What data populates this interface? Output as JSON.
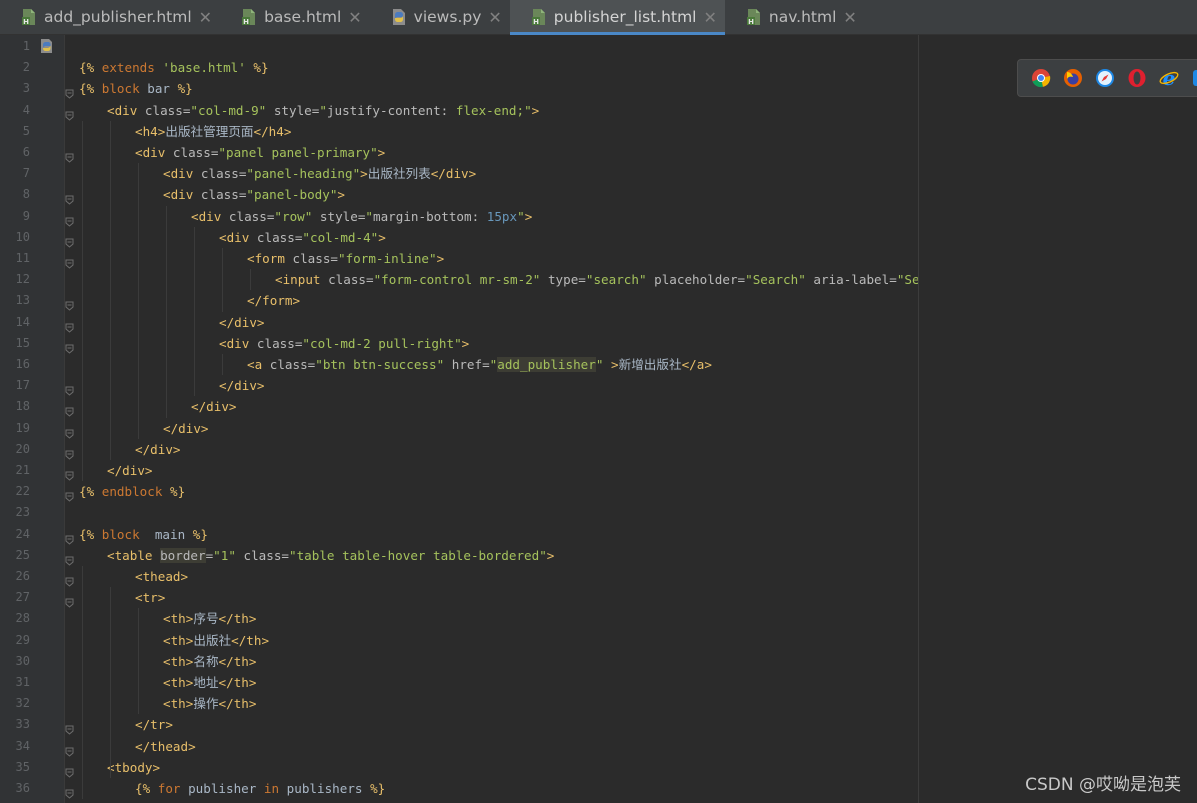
{
  "tabs": [
    {
      "label": "add_publisher.html",
      "type": "html",
      "active": false
    },
    {
      "label": "base.html",
      "type": "html",
      "active": false
    },
    {
      "label": "views.py",
      "type": "python",
      "active": false
    },
    {
      "label": "publisher_list.html",
      "type": "html",
      "active": true
    },
    {
      "label": "nav.html",
      "type": "html",
      "active": false
    }
  ],
  "close_glyph": "✕",
  "browser_icons": [
    "chrome-icon",
    "firefox-icon",
    "safari-icon",
    "opera-icon",
    "ie-icon",
    "edge-icon"
  ],
  "watermark": "CSDN @哎呦是泡芙",
  "code_lines": [
    {
      "n": "1",
      "indent": 0,
      "tokens": []
    },
    {
      "n": "2",
      "indent": 0,
      "tokens": [
        [
          "tpl",
          "{% "
        ],
        [
          "kw",
          "extends"
        ],
        [
          "text",
          " "
        ],
        [
          "val",
          "'base.html'"
        ],
        [
          "tpl",
          " %}"
        ]
      ]
    },
    {
      "n": "3",
      "indent": 0,
      "tokens": [
        [
          "tpl",
          "{% "
        ],
        [
          "kw",
          "block"
        ],
        [
          "text",
          " bar "
        ],
        [
          "tpl",
          "%}"
        ]
      ]
    },
    {
      "n": "4",
      "indent": 1,
      "tokens": [
        [
          "tag",
          "<div "
        ],
        [
          "attr",
          "class="
        ],
        [
          "val",
          "\"col-md-9\""
        ],
        [
          "attr",
          " style="
        ],
        [
          "val",
          "\""
        ],
        [
          "attr",
          "justify-content: "
        ],
        [
          "val",
          "flex-end;\""
        ],
        [
          "tag",
          ">"
        ]
      ]
    },
    {
      "n": "5",
      "indent": 2,
      "tokens": [
        [
          "tag",
          "<h4>"
        ],
        [
          "text",
          "出版社管理页面"
        ],
        [
          "tag",
          "</h4>"
        ]
      ]
    },
    {
      "n": "6",
      "indent": 2,
      "tokens": [
        [
          "tag",
          "<div "
        ],
        [
          "attr",
          "class="
        ],
        [
          "val",
          "\"panel panel-primary\""
        ],
        [
          "tag",
          ">"
        ]
      ]
    },
    {
      "n": "7",
      "indent": 3,
      "tokens": [
        [
          "tag",
          "<div "
        ],
        [
          "attr",
          "class="
        ],
        [
          "val",
          "\"panel-heading\""
        ],
        [
          "tag",
          ">"
        ],
        [
          "text",
          "出版社列表"
        ],
        [
          "tag",
          "</div>"
        ]
      ]
    },
    {
      "n": "8",
      "indent": 3,
      "tokens": [
        [
          "tag",
          "<div "
        ],
        [
          "attr",
          "class="
        ],
        [
          "val",
          "\"panel-body\""
        ],
        [
          "tag",
          ">"
        ]
      ]
    },
    {
      "n": "9",
      "indent": 4,
      "tokens": [
        [
          "tag",
          "<div "
        ],
        [
          "attr",
          "class="
        ],
        [
          "val",
          "\"row\""
        ],
        [
          "attr",
          " style="
        ],
        [
          "val",
          "\""
        ],
        [
          "attr",
          "margin-bottom: "
        ],
        [
          "num",
          "15px"
        ],
        [
          "val",
          "\""
        ],
        [
          "tag",
          ">"
        ]
      ]
    },
    {
      "n": "10",
      "indent": 5,
      "tokens": [
        [
          "tag",
          "<div "
        ],
        [
          "attr",
          "class="
        ],
        [
          "val",
          "\"col-md-4\""
        ],
        [
          "tag",
          ">"
        ]
      ]
    },
    {
      "n": "11",
      "indent": 6,
      "tokens": [
        [
          "tag",
          "<form "
        ],
        [
          "attr",
          "class="
        ],
        [
          "val",
          "\"form-inline\""
        ],
        [
          "tag",
          ">"
        ]
      ]
    },
    {
      "n": "12",
      "indent": 7,
      "tokens": [
        [
          "tag",
          "<input "
        ],
        [
          "attr",
          "class="
        ],
        [
          "val",
          "\"form-control mr-sm-2\""
        ],
        [
          "attr",
          " type="
        ],
        [
          "val",
          "\"search\""
        ],
        [
          "attr",
          " placeholder="
        ],
        [
          "val",
          "\"Search\""
        ],
        [
          "attr",
          " aria-label="
        ],
        [
          "val",
          "\"Search\""
        ],
        [
          "tag",
          ">"
        ]
      ]
    },
    {
      "n": "13",
      "indent": 6,
      "tokens": [
        [
          "tag",
          "</form>"
        ]
      ]
    },
    {
      "n": "14",
      "indent": 5,
      "tokens": [
        [
          "tag",
          "</div>"
        ]
      ]
    },
    {
      "n": "15",
      "indent": 5,
      "tokens": [
        [
          "tag",
          "<div "
        ],
        [
          "attr",
          "class="
        ],
        [
          "val",
          "\"col-md-2 pull-right\""
        ],
        [
          "tag",
          ">"
        ]
      ]
    },
    {
      "n": "16",
      "indent": 6,
      "tokens": [
        [
          "tag",
          "<a "
        ],
        [
          "attr",
          "class="
        ],
        [
          "val",
          "\"btn btn-success\""
        ],
        [
          "attr",
          " href="
        ],
        [
          "val",
          "\""
        ],
        [
          "hl",
          "add_publisher"
        ],
        [
          "val",
          "\""
        ],
        [
          "text",
          " "
        ],
        [
          "tag",
          ">"
        ],
        [
          "text",
          "新增出版社"
        ],
        [
          "tag",
          "</a>"
        ]
      ]
    },
    {
      "n": "17",
      "indent": 5,
      "tokens": [
        [
          "tag",
          "</div>"
        ]
      ]
    },
    {
      "n": "18",
      "indent": 4,
      "tokens": [
        [
          "tag",
          "</div>"
        ]
      ]
    },
    {
      "n": "19",
      "indent": 3,
      "tokens": [
        [
          "tag",
          "</div>"
        ]
      ]
    },
    {
      "n": "20",
      "indent": 2,
      "tokens": [
        [
          "tag",
          "</div>"
        ]
      ]
    },
    {
      "n": "21",
      "indent": 1,
      "tokens": [
        [
          "tag",
          "</div>"
        ]
      ]
    },
    {
      "n": "22",
      "indent": 0,
      "tokens": [
        [
          "tpl",
          "{% "
        ],
        [
          "kw",
          "endblock"
        ],
        [
          "text",
          " "
        ],
        [
          "tpl",
          "%}"
        ]
      ]
    },
    {
      "n": "23",
      "indent": 0,
      "tokens": []
    },
    {
      "n": "24",
      "indent": 0,
      "tokens": [
        [
          "tpl",
          "{% "
        ],
        [
          "kw",
          "block"
        ],
        [
          "text",
          "  main "
        ],
        [
          "tpl",
          "%}"
        ]
      ]
    },
    {
      "n": "25",
      "indent": 1,
      "tokens": [
        [
          "tag",
          "<table "
        ],
        [
          "hl2",
          "border"
        ],
        [
          "attr",
          "="
        ],
        [
          "val",
          "\"1\""
        ],
        [
          "attr",
          " class="
        ],
        [
          "val",
          "\"table table-hover table-bordered\""
        ],
        [
          "tag",
          ">"
        ]
      ]
    },
    {
      "n": "26",
      "indent": 2,
      "tokens": [
        [
          "tag",
          "<thead>"
        ]
      ]
    },
    {
      "n": "27",
      "indent": 2,
      "tokens": [
        [
          "tag",
          "<tr>"
        ]
      ]
    },
    {
      "n": "28",
      "indent": 3,
      "tokens": [
        [
          "tag",
          "<th>"
        ],
        [
          "text",
          "序号"
        ],
        [
          "tag",
          "</th>"
        ]
      ]
    },
    {
      "n": "29",
      "indent": 3,
      "tokens": [
        [
          "tag",
          "<th>"
        ],
        [
          "text",
          "出版社"
        ],
        [
          "tag",
          "</th>"
        ]
      ]
    },
    {
      "n": "30",
      "indent": 3,
      "tokens": [
        [
          "tag",
          "<th>"
        ],
        [
          "text",
          "名称"
        ],
        [
          "tag",
          "</th>"
        ]
      ]
    },
    {
      "n": "31",
      "indent": 3,
      "tokens": [
        [
          "tag",
          "<th>"
        ],
        [
          "text",
          "地址"
        ],
        [
          "tag",
          "</th>"
        ]
      ]
    },
    {
      "n": "32",
      "indent": 3,
      "tokens": [
        [
          "tag",
          "<th>"
        ],
        [
          "text",
          "操作"
        ],
        [
          "tag",
          "</th>"
        ]
      ]
    },
    {
      "n": "33",
      "indent": 2,
      "tokens": [
        [
          "tag",
          "</tr>"
        ]
      ]
    },
    {
      "n": "34",
      "indent": 2,
      "tokens": [
        [
          "tag",
          "</thead>"
        ]
      ]
    },
    {
      "n": "35",
      "indent": 1,
      "tokens": [
        [
          "tag",
          "<tbody>"
        ]
      ]
    },
    {
      "n": "36",
      "indent": 2,
      "tokens": [
        [
          "tpl",
          "{% "
        ],
        [
          "kw",
          "for"
        ],
        [
          "text",
          " publisher "
        ],
        [
          "kw",
          "in"
        ],
        [
          "text",
          " publishers "
        ],
        [
          "tpl",
          "%}"
        ]
      ]
    }
  ],
  "fold_lines": [
    "3",
    "4",
    "6",
    "8",
    "9",
    "10",
    "11",
    "13",
    "14",
    "15",
    "17",
    "18",
    "19",
    "20",
    "21",
    "22",
    "24",
    "25",
    "26",
    "27",
    "33",
    "34",
    "35",
    "36"
  ]
}
